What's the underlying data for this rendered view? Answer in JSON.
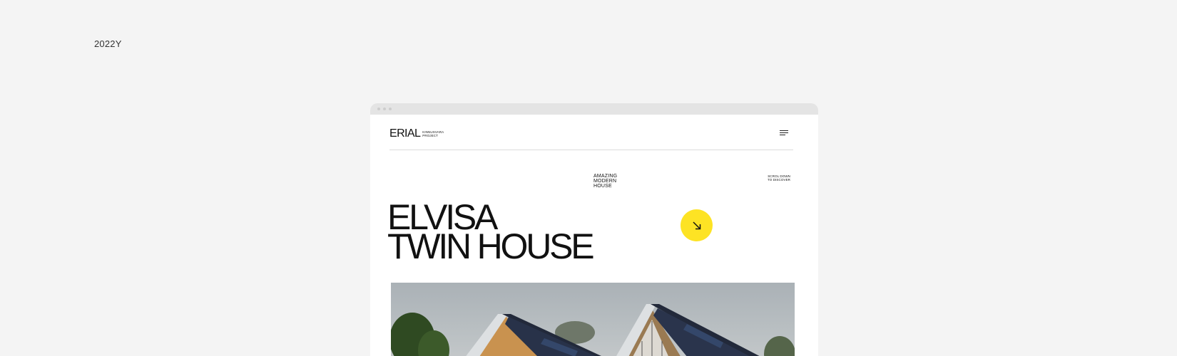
{
  "page": {
    "year_label": "2022Y"
  },
  "site": {
    "logo": {
      "word": "ERIAL",
      "sub_line1": "KINNUSVARA",
      "sub_line2": "PROJECT"
    },
    "tagline": [
      "AMAZING",
      "MODERN",
      "HOUSE"
    ],
    "scroll_hint": [
      "SCROL DOWN",
      "TO DISCOVER"
    ],
    "hero": {
      "title_line1": "ELVISA",
      "title_line2": "TWIN HOUSE"
    },
    "icons": {
      "menu": "menu-icon",
      "arrow": "arrow-down-right-icon"
    },
    "colors": {
      "accent": "#fde324",
      "text": "#111111",
      "background": "#f4f4f4",
      "window_bar": "#e4e4e4"
    }
  }
}
